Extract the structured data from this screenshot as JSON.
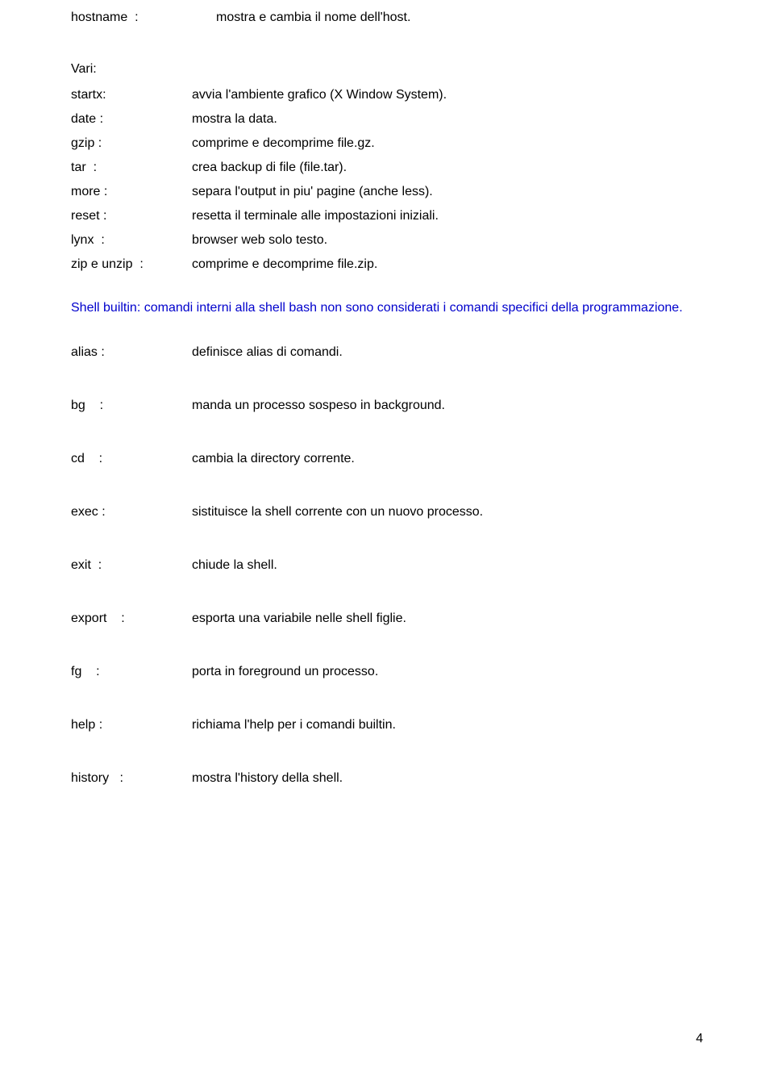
{
  "top": {
    "cmd": "hostname  :",
    "desc": "mostra e cambia il nome dell'host."
  },
  "vari_label": "Vari:",
  "vari": [
    {
      "cmd": "startx:",
      "desc": "avvia l'ambiente grafico (X Window System)."
    },
    {
      "cmd": "date :",
      "desc": "mostra la data."
    },
    {
      "cmd": "gzip :",
      "desc": "comprime e decomprime file.gz."
    },
    {
      "cmd": "tar  :",
      "desc": "crea backup di file (file.tar)."
    },
    {
      "cmd": "more :",
      "desc": "separa l'output in piu' pagine (anche less)."
    },
    {
      "cmd": "reset :",
      "desc": "resetta il terminale alle impostazioni iniziali."
    },
    {
      "cmd": "lynx  :",
      "desc": "browser web solo testo."
    },
    {
      "cmd": "zip e unzip  :",
      "desc": "comprime e decomprime file.zip."
    }
  ],
  "shell_builtin_para": "Shell builtin: comandi interni alla shell bash non sono considerati i comandi specifici della programmazione.",
  "builtins": [
    {
      "cmd": "alias :",
      "desc": "definisce alias di comandi."
    },
    {
      "cmd": "bg    :",
      "desc": "manda un processo sospeso in background."
    },
    {
      "cmd": "cd    :",
      "desc": "cambia la directory corrente."
    },
    {
      "cmd": "exec :",
      "desc": "sistituisce la shell corrente con un nuovo processo."
    },
    {
      "cmd": "exit  :",
      "desc": "chiude la shell."
    },
    {
      "cmd": "export    :",
      "desc": "esporta una variabile nelle shell figlie."
    },
    {
      "cmd": "fg    :",
      "desc": "porta in foreground un processo."
    },
    {
      "cmd": "help :",
      "desc": "richiama l'help per i comandi builtin."
    },
    {
      "cmd": "history   :",
      "desc": "mostra l'history della shell."
    }
  ],
  "page_number": "4",
  "layout": {
    "vari_cmd_width": 150,
    "builtin_cmd_width": 150
  }
}
